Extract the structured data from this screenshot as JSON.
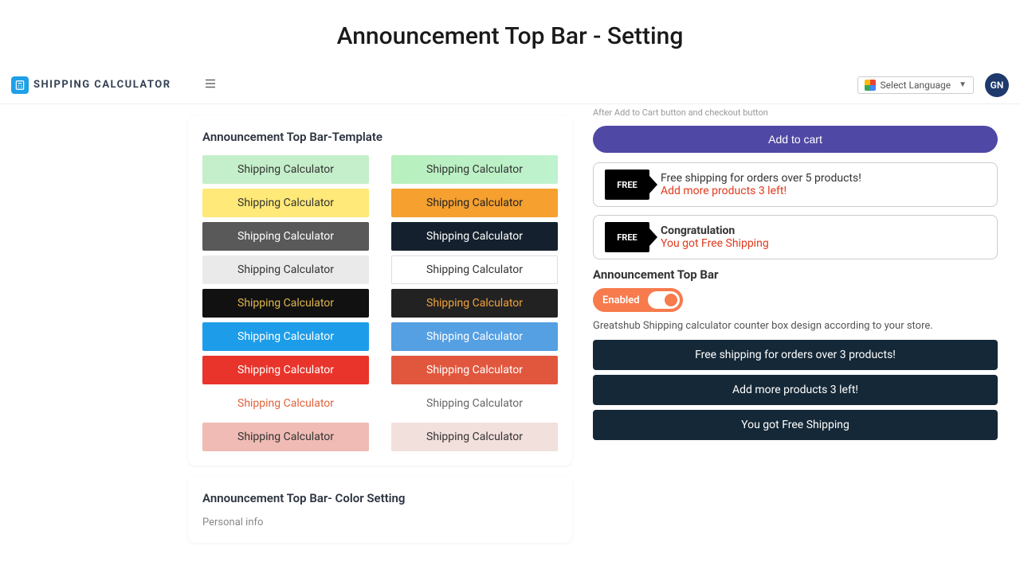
{
  "page_title": "Announcement Top Bar - Setting",
  "brand": "SHIPPING CALCULATOR",
  "lang_selector": "Select Language",
  "avatar_initials": "GN",
  "left": {
    "template_heading": "Announcement Top Bar-Template",
    "template_label": "Shipping Calculator",
    "color_heading": "Announcement Top Bar- Color Setting",
    "color_sub": "Personal info"
  },
  "right": {
    "subtext_over": "After Add to Cart button and checkout button",
    "add_to_cart": "Add to cart",
    "promo1_line1": "Free shipping for orders over 5 products!",
    "promo1_line2": "Add more products 3 left!",
    "promo2_line1": "Congratulation",
    "promo2_line2": "You got Free Shipping",
    "section_label": "Announcement Top Bar",
    "toggle_label": "Enabled",
    "desc": "Greatshub Shipping calculator counter box design according to your store.",
    "bars": [
      "Free shipping for orders over 3 products!",
      "Add more products 3 left!",
      "You got Free Shipping"
    ],
    "truck_label": "FREE"
  }
}
